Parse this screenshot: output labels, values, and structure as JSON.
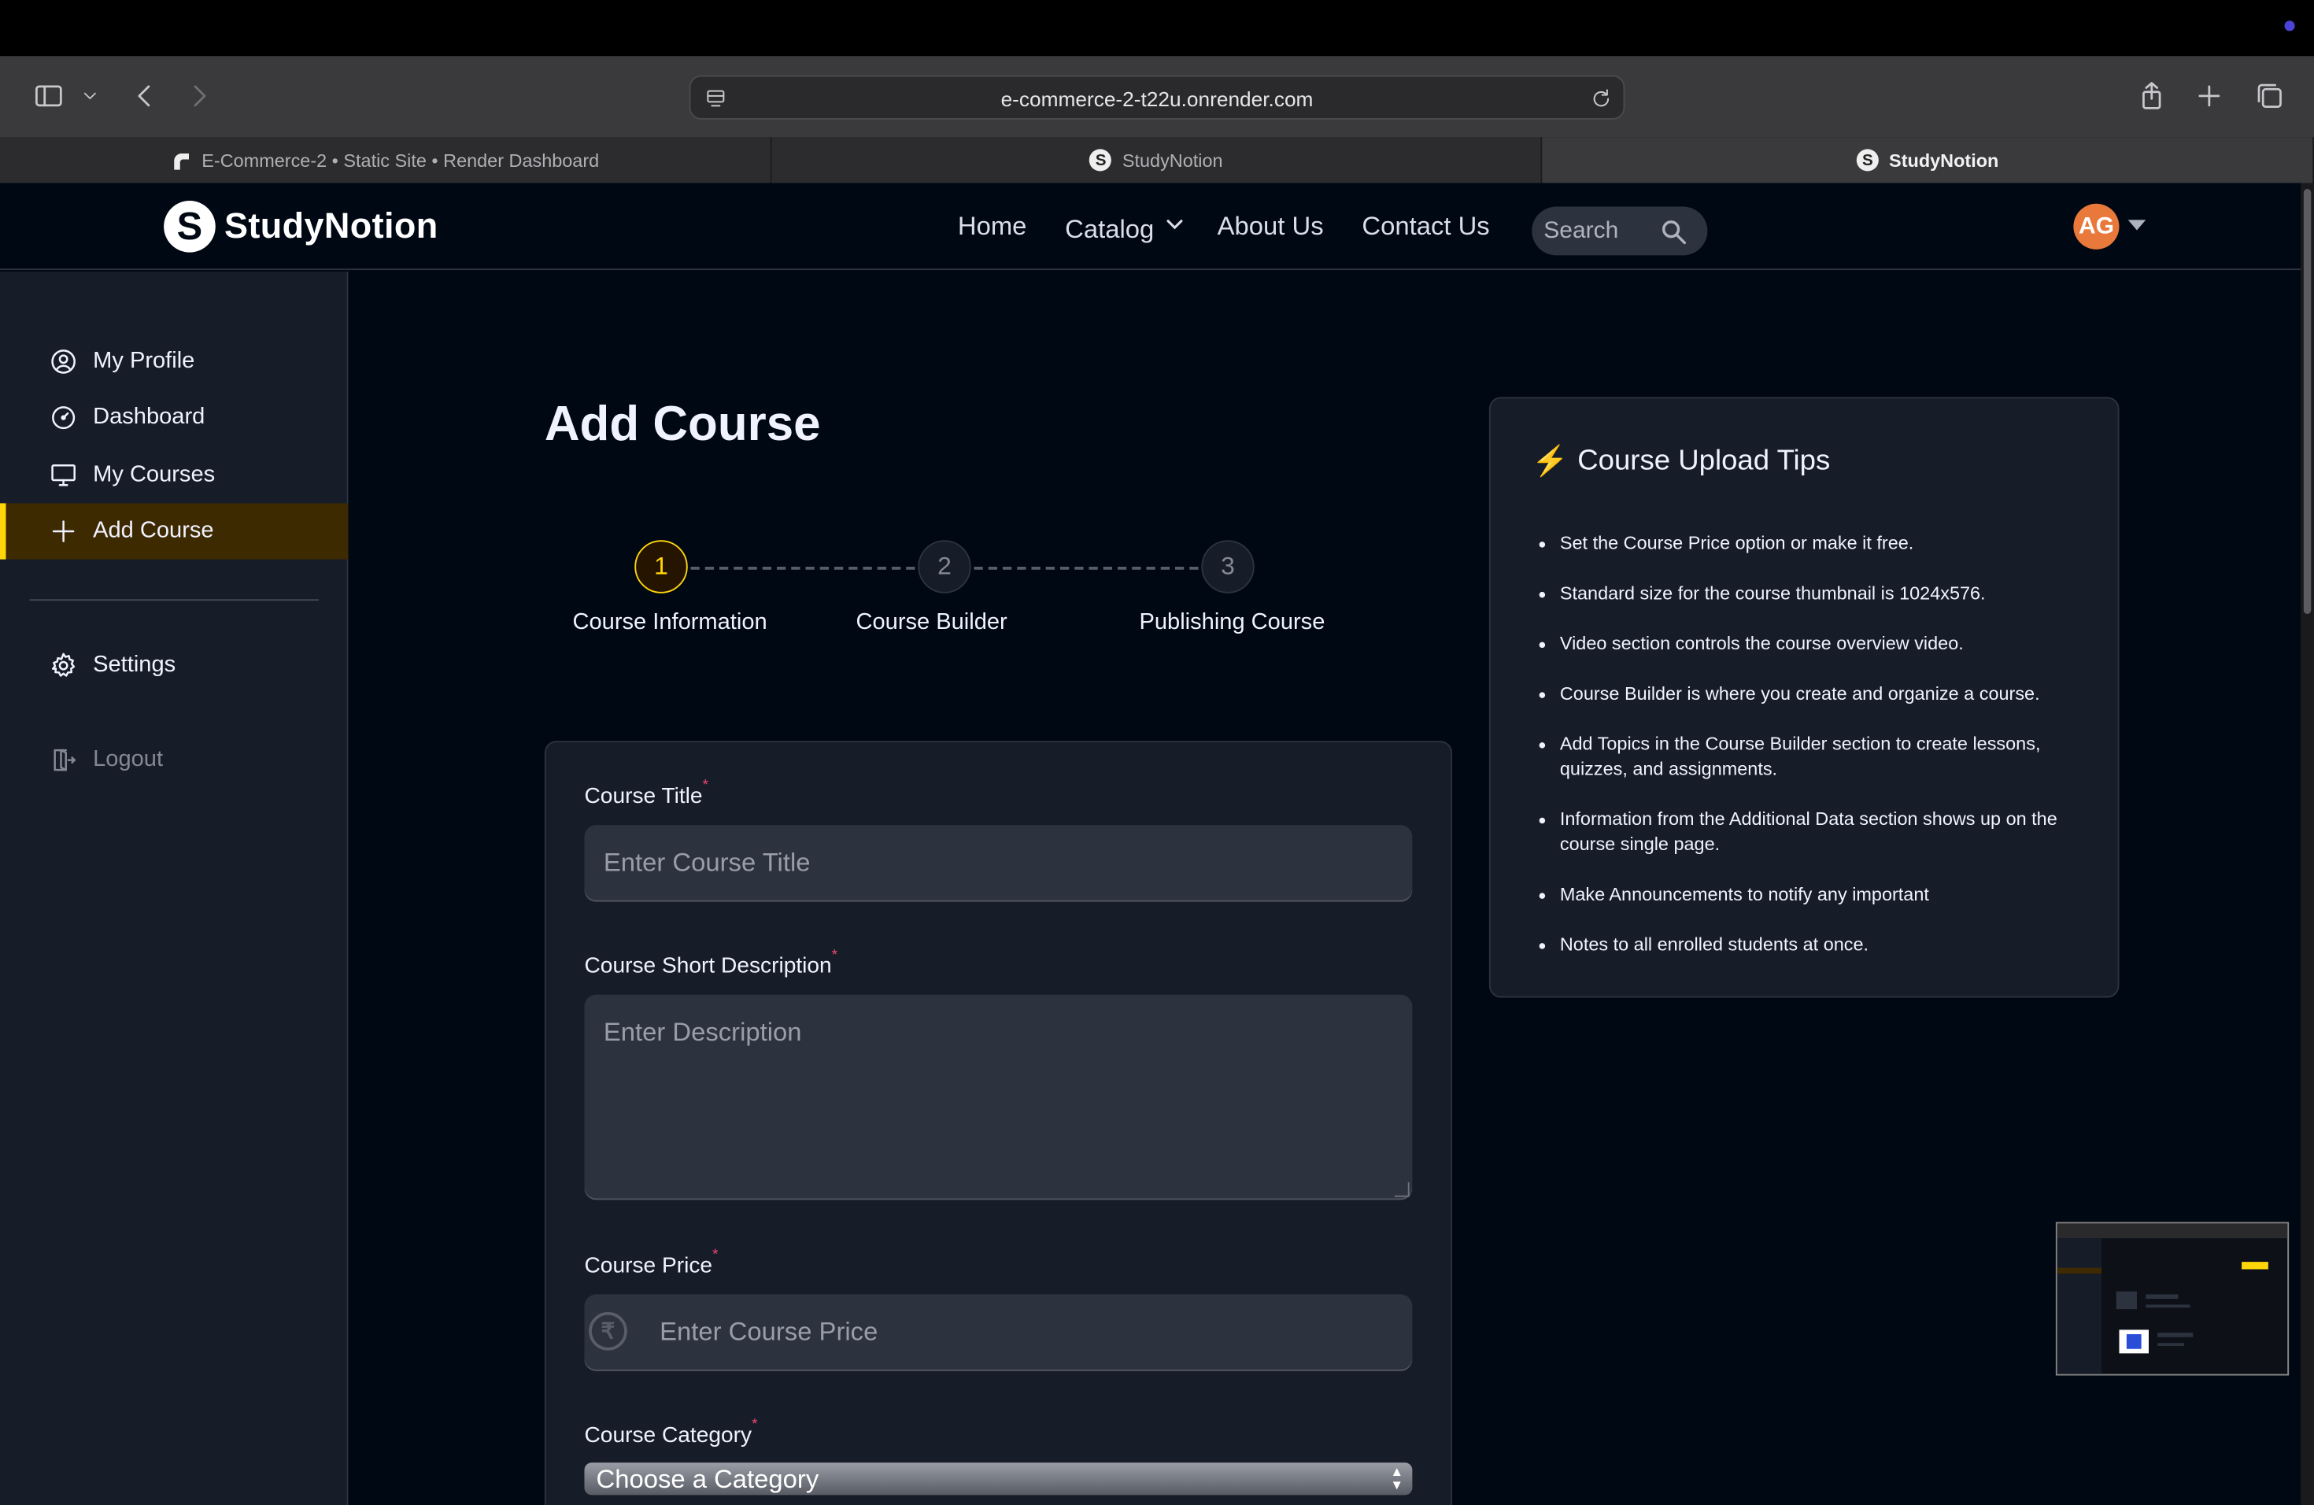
{
  "browser": {
    "url": "e-commerce-2-t22u.onrender.com",
    "tabs": [
      {
        "label": "E-Commerce-2  •  Static Site  •  Render Dashboard",
        "active": false,
        "favicon": "render-icon"
      },
      {
        "label": "StudyNotion",
        "active": false,
        "favicon": "studynotion-icon"
      },
      {
        "label": "StudyNotion",
        "active": true,
        "favicon": "studynotion-icon"
      }
    ]
  },
  "nav": {
    "logo_mark": "S",
    "logo_text": "StudyNotion",
    "links": [
      "Home",
      "Catalog",
      "About Us",
      "Contact Us"
    ],
    "search_placeholder": "Search",
    "avatar_initials": "AG"
  },
  "sidebar": {
    "items": [
      {
        "label": "My Profile",
        "icon": "user-circle-icon"
      },
      {
        "label": "Dashboard",
        "icon": "gauge-icon"
      },
      {
        "label": "My Courses",
        "icon": "monitor-icon"
      },
      {
        "label": "Add Course",
        "icon": "plus-icon",
        "active": true
      }
    ],
    "settings_label": "Settings",
    "logout_label": "Logout"
  },
  "main": {
    "title": "Add Course",
    "steps": [
      {
        "number": "1",
        "label": "Course Information",
        "active": true
      },
      {
        "number": "2",
        "label": "Course Builder",
        "active": false
      },
      {
        "number": "3",
        "label": "Publishing Course",
        "active": false
      }
    ],
    "form": {
      "title_label": "Course Title",
      "title_placeholder": "Enter Course Title",
      "desc_label": "Course Short Description",
      "desc_placeholder": "Enter Description",
      "price_label": "Course Price",
      "price_placeholder": "Enter Course Price",
      "price_symbol": "₹",
      "category_label": "Course Category",
      "category_value": "Choose a Category",
      "required_mark": "*"
    }
  },
  "tips": {
    "icon": "⚡",
    "title": "Course Upload Tips",
    "items": [
      "Set the Course Price option or make it free.",
      "Standard size for the course thumbnail is 1024x576.",
      "Video section controls the course overview video.",
      "Course Builder is where you create and organize a course.",
      "Add Topics in the Course Builder section to create lessons, quizzes, and assignments.",
      "Information from the Additional Data section shows up on the course single page.",
      "Make Announcements to notify any important",
      "Notes to all enrolled students at once."
    ]
  },
  "colors": {
    "accent": "#FFD60A",
    "background": "#000814",
    "panel": "#161D29",
    "input": "#2C333F",
    "required": "#EF476F",
    "avatar": "#e8793a"
  }
}
